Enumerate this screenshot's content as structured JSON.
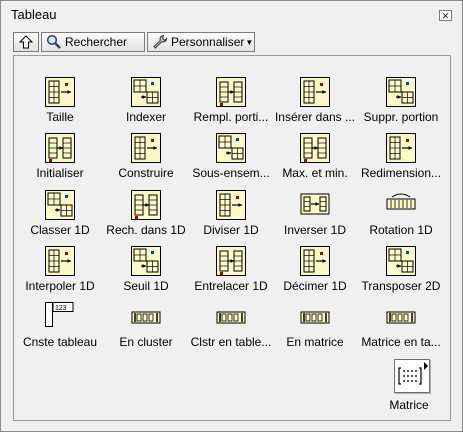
{
  "window": {
    "title": "Tableau"
  },
  "toolbar": {
    "search_label": "Rechercher",
    "customize_label": "Personnaliser"
  },
  "palette": {
    "rows": [
      [
        {
          "label": "Taille",
          "icon": "array-size"
        },
        {
          "label": "Indexer",
          "icon": "index-array"
        },
        {
          "label": "Rempl. porti...",
          "icon": "replace-subset"
        },
        {
          "label": "Insérer dans ...",
          "icon": "insert-into-array"
        },
        {
          "label": "Suppr. portion",
          "icon": "delete-from-array"
        }
      ],
      [
        {
          "label": "Initialiser",
          "icon": "initialize-array"
        },
        {
          "label": "Construire",
          "icon": "build-array"
        },
        {
          "label": "Sous-ensem...",
          "icon": "array-subset"
        },
        {
          "label": "Max. et min.",
          "icon": "array-max-min"
        },
        {
          "label": "Redimension...",
          "icon": "reshape-array"
        }
      ],
      [
        {
          "label": "Classer 1D",
          "icon": "sort-1d"
        },
        {
          "label": "Rech. dans 1D",
          "icon": "search-1d"
        },
        {
          "label": "Diviser 1D",
          "icon": "split-1d"
        },
        {
          "label": "Inverser 1D",
          "icon": "reverse-1d"
        },
        {
          "label": "Rotation 1D",
          "icon": "rotate-1d"
        }
      ],
      [
        {
          "label": "Interpoler 1D",
          "icon": "interpolate-1d"
        },
        {
          "label": "Seuil 1D",
          "icon": "threshold-1d"
        },
        {
          "label": "Entrelacer 1D",
          "icon": "interleave-1d"
        },
        {
          "label": "Décimer 1D",
          "icon": "decimate-1d"
        },
        {
          "label": "Transposer 2D",
          "icon": "transpose-2d"
        }
      ],
      [
        {
          "label": "Cnste tableau",
          "icon": "array-constant"
        },
        {
          "label": "En cluster",
          "icon": "array-to-cluster"
        },
        {
          "label": "Clstr en table...",
          "icon": "cluster-to-array"
        },
        {
          "label": "En matrice",
          "icon": "array-to-matrix"
        },
        {
          "label": "Matrice en ta...",
          "icon": "matrix-to-array"
        }
      ]
    ],
    "subpalette": {
      "label": "Matrice",
      "icon": "matrix-subpalette"
    },
    "constant_value": "123"
  }
}
